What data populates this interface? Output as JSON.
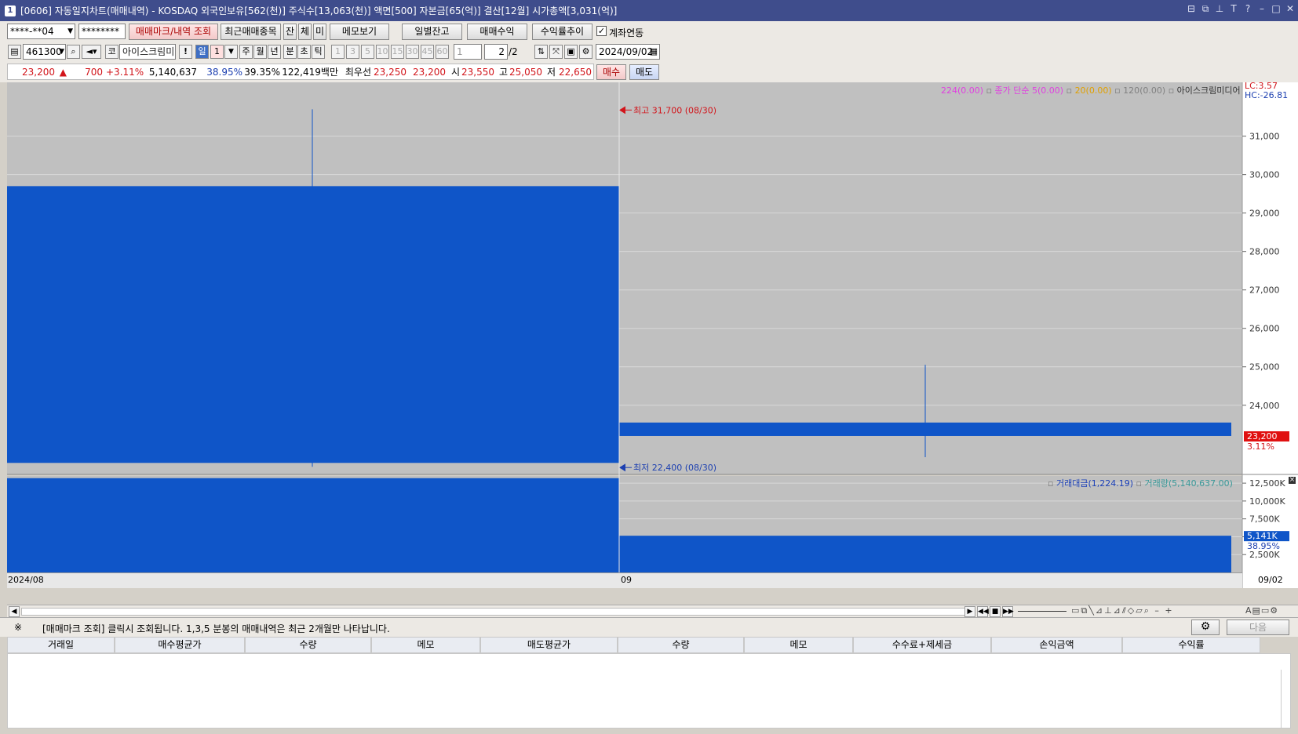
{
  "window": {
    "title": "[0606] 자동일지차트(매매내역) - KOSDAQ 외국인보유[562(천)] 주식수[13,063(천)] 액면[500] 자본금[65(억)] 결산[12월] 시가총액[3,031(억)]",
    "icon_label": "1"
  },
  "toolbar1": {
    "account": "****-**04",
    "password": "********",
    "trade_mark_btn": "매매마크/내역 조회",
    "recent_btn": "최근매매종목",
    "jan": "잔",
    "che": "체",
    "mi": "미",
    "memo_btn": "메모보기",
    "daily_btn": "일별잔고",
    "profit_btn": "매매수익",
    "return_btn": "수익률추이",
    "account_link": "계좌연동"
  },
  "toolbar2": {
    "code": "461300",
    "market": "코",
    "stock_name": "아이스크림미디어",
    "exclaim": "!",
    "periods": [
      "일",
      "1",
      "주",
      "월",
      "년",
      "분",
      "초",
      "틱"
    ],
    "minutes": [
      "1",
      "3",
      "5",
      "10",
      "15",
      "30",
      "45",
      "60"
    ],
    "minute_value": "1",
    "page": "2",
    "page_total": "/2",
    "date": "2024/09/02"
  },
  "quote": {
    "price": "23,200",
    "arrow": "▲",
    "change": "700",
    "rate": "+3.11%",
    "volume": "5,140,637",
    "v_rate": "38.95%",
    "v_rate2": "39.35%",
    "amount": "122,419백만",
    "best_label": "최우선",
    "ask": "23,250",
    "bid": "23,200",
    "open_label": "시",
    "open": "23,550",
    "high_label": "고",
    "high": "25,050",
    "low_label": "저",
    "low": "22,650",
    "buy_btn": "매수",
    "sell_btn": "매도"
  },
  "chart_data": [
    {
      "type": "candlestick",
      "title": "",
      "legend": [
        {
          "text": "224(0.00)",
          "color": "#e040e0"
        },
        {
          "text": "종가 단순 5(0.00)",
          "color": "#e040e0"
        },
        {
          "text": "20(0.00)",
          "color": "#e0a000"
        },
        {
          "text": "120(0.00)",
          "color": "#808080"
        },
        {
          "text": "아이스크림미디어",
          "color": "#333333"
        }
      ],
      "lc": "LC:3.57",
      "hc": "HC:-26.81",
      "ylim": [
        22200,
        32400
      ],
      "yticks": [
        24000,
        25000,
        26000,
        27000,
        28000,
        29000,
        30000,
        31000
      ],
      "ytick_labels": [
        "24,000",
        "25,000",
        "26,000",
        "27,000",
        "28,000",
        "29,000",
        "30,000",
        "31,000"
      ],
      "candles": [
        {
          "x": "2024/08/30",
          "open": 29700,
          "high": 31700,
          "low": 22400,
          "close": 22500
        },
        {
          "x": "2024/09/02",
          "open": 23550,
          "high": 25050,
          "low": 22650,
          "close": 23200
        }
      ],
      "high_note": "최고 31,700 (08/30)",
      "low_note": "최저 22,400 (08/30)",
      "last_price": "23,200",
      "last_rate": "3.11%",
      "candle_color": "#0f55c8",
      "price_tag_color": "#e01010"
    },
    {
      "type": "bar",
      "legend": [
        {
          "text": "거래대금(1,224.19)",
          "color": "#1a3fb8"
        },
        {
          "text": "거래량(5,140,637.00)",
          "color": "#3a9a9a"
        }
      ],
      "ylim": [
        0,
        13500
      ],
      "yticks": [
        2500,
        5000,
        7500,
        10000,
        12500
      ],
      "ytick_labels": [
        "2,500K",
        "5,000K",
        "7,500K",
        "10,000K",
        "12,500K"
      ],
      "categories": [
        "2024/08/30",
        "2024/09/02"
      ],
      "values": [
        13200,
        5141
      ],
      "last_value": "5,141K",
      "last_rate": "38.95%"
    }
  ],
  "xaxis": {
    "left": "2024/08",
    "mid": "09",
    "right": "09/02"
  },
  "status": {
    "mark": "※",
    "message": "[매매마크 조회] 클릭시 조회됩니다. 1,3,5 분봉의 매매내역은 최근 2개월만 나타납니다.",
    "next_btn": "다음"
  },
  "table": {
    "headers": [
      "거래일",
      "매수평균가",
      "수량",
      "메모",
      "매도평균가",
      "수량",
      "메모",
      "수수료+제세금",
      "손익금액",
      "수익률"
    ]
  }
}
